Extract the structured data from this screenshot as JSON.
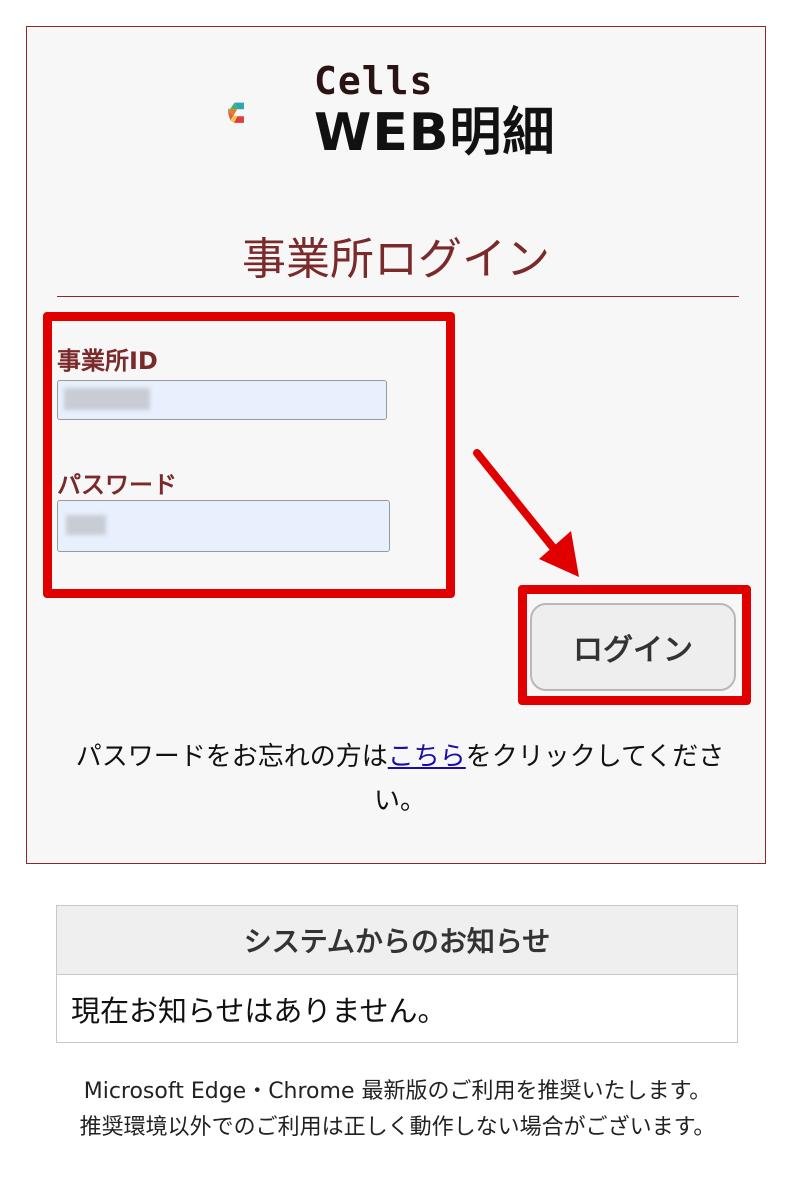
{
  "brand": {
    "line1": "Cells",
    "line2": "WEB明細"
  },
  "login": {
    "title": "事業所ログイン",
    "office_id_label": "事業所ID",
    "password_label": "パスワード",
    "submit_label": "ログイン",
    "forgot_prefix": "パスワードをお忘れの方は",
    "forgot_link": "こちら",
    "forgot_suffix": "をクリックしてください。"
  },
  "notice": {
    "heading": "システムからのお知らせ",
    "body": "現在お知らせはありません。"
  },
  "footer": {
    "line1": "Microsoft Edge・Chrome 最新版のご利用を推奨いたします。",
    "line2": "推奨環境以外でのご利用は正しく動作しない場合がございます。"
  },
  "colors": {
    "accent": "#7a2a2a",
    "annotation_red": "#e00000",
    "input_bg": "#e8f0fe",
    "card_bg": "#f7f7f7"
  }
}
